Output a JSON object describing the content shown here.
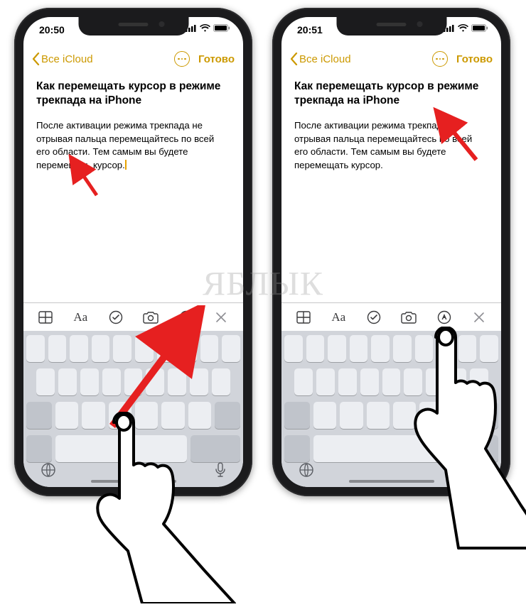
{
  "watermark": "ЯБЛЫК",
  "screens": {
    "left": {
      "time": "20:50",
      "back_label": "Все iCloud",
      "done_label": "Готово",
      "note_title": "Как перемещать курсор в режиме трекпада на iPhone",
      "note_text_before": "После активации режима трекпада не отрывая пальца перемещайтесь по всей его области. Тем самым вы будете перемещать курсор.",
      "note_text_after": "",
      "toolbar_aa": "Aa"
    },
    "right": {
      "time": "20:51",
      "back_label": "Все iCloud",
      "done_label": "Готово",
      "note_title": "Как перемещать курсор в режиме трекпада на iPhone",
      "note_text_before": "После активации режима трекпада",
      "note_text_after": " не отрывая пальца перемещайтесь по всей его области. Тем самым вы будете перемещать курсор.",
      "toolbar_aa": "Aa"
    }
  }
}
